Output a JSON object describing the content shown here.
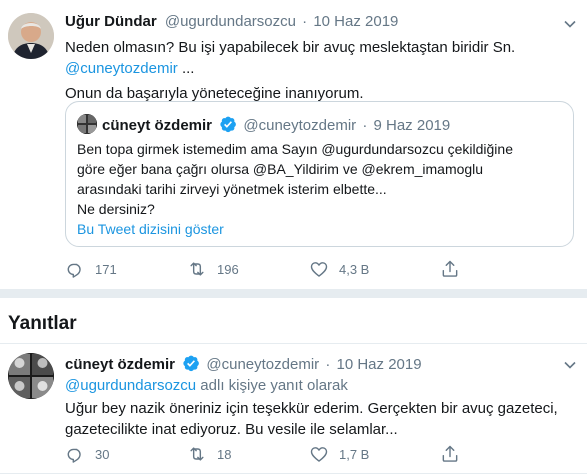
{
  "main_tweet": {
    "name": "Uğur Dündar",
    "handle": "@ugurdundarsozcu",
    "separator": "·",
    "time": "10 Haz 2019",
    "text_line1": "Neden olmasın? Bu işi yapabilecek bir avuç meslektaştan biridir Sn.",
    "mention": "@cuneytozdemir",
    "ellipsis": " ...",
    "text_line3": "Onun da başarıyla yöneteceğine inanıyorum.",
    "quote": {
      "name": "cüneyt özdemir",
      "handle": "@cuneytozdemir",
      "separator": "·",
      "time": "9 Haz 2019",
      "lines": [
        "Ben topa girmek istemedim ama Sayın @ugurdundarsozcu  çekildiğine",
        "göre eğer bana çağrı olursa @BA_Yildirim ve @ekrem_imamoglu",
        "arasındaki tarihi zirveyi yönetmek isterim elbette...",
        "Ne dersiniz?"
      ],
      "show_thread": "Bu Tweet dizisini göster"
    },
    "actions": {
      "replies": "171",
      "retweets": "196",
      "likes": "4,3 B",
      "share": ""
    }
  },
  "replies_header": "Yanıtlar",
  "reply_tweet": {
    "name": "cüneyt özdemir",
    "handle": "@cuneytozdemir",
    "separator": "·",
    "time": "10 Haz 2019",
    "reply_to_mention": "@ugurdundarsozcu",
    "reply_to_suffix": " adlı kişiye yanıt olarak",
    "text_line1": "Uğur bey nazik öneriniz için teşekkür ederim. Gerçekten bir avuç gazeteci,",
    "text_line2": "gazetecilikte inat ediyoruz. Bu vesile ile selamlar...",
    "actions": {
      "replies": "30",
      "retweets": "18",
      "likes": "1,7 B",
      "share": ""
    }
  },
  "colors": {
    "link": "#1b95e0",
    "muted": "#657786",
    "border": "#e6ecf0",
    "verified": "#1da1f2"
  },
  "icons": [
    "chevron-down-icon",
    "reply-icon",
    "retweet-icon",
    "like-icon",
    "share-icon",
    "verified-badge-icon"
  ]
}
